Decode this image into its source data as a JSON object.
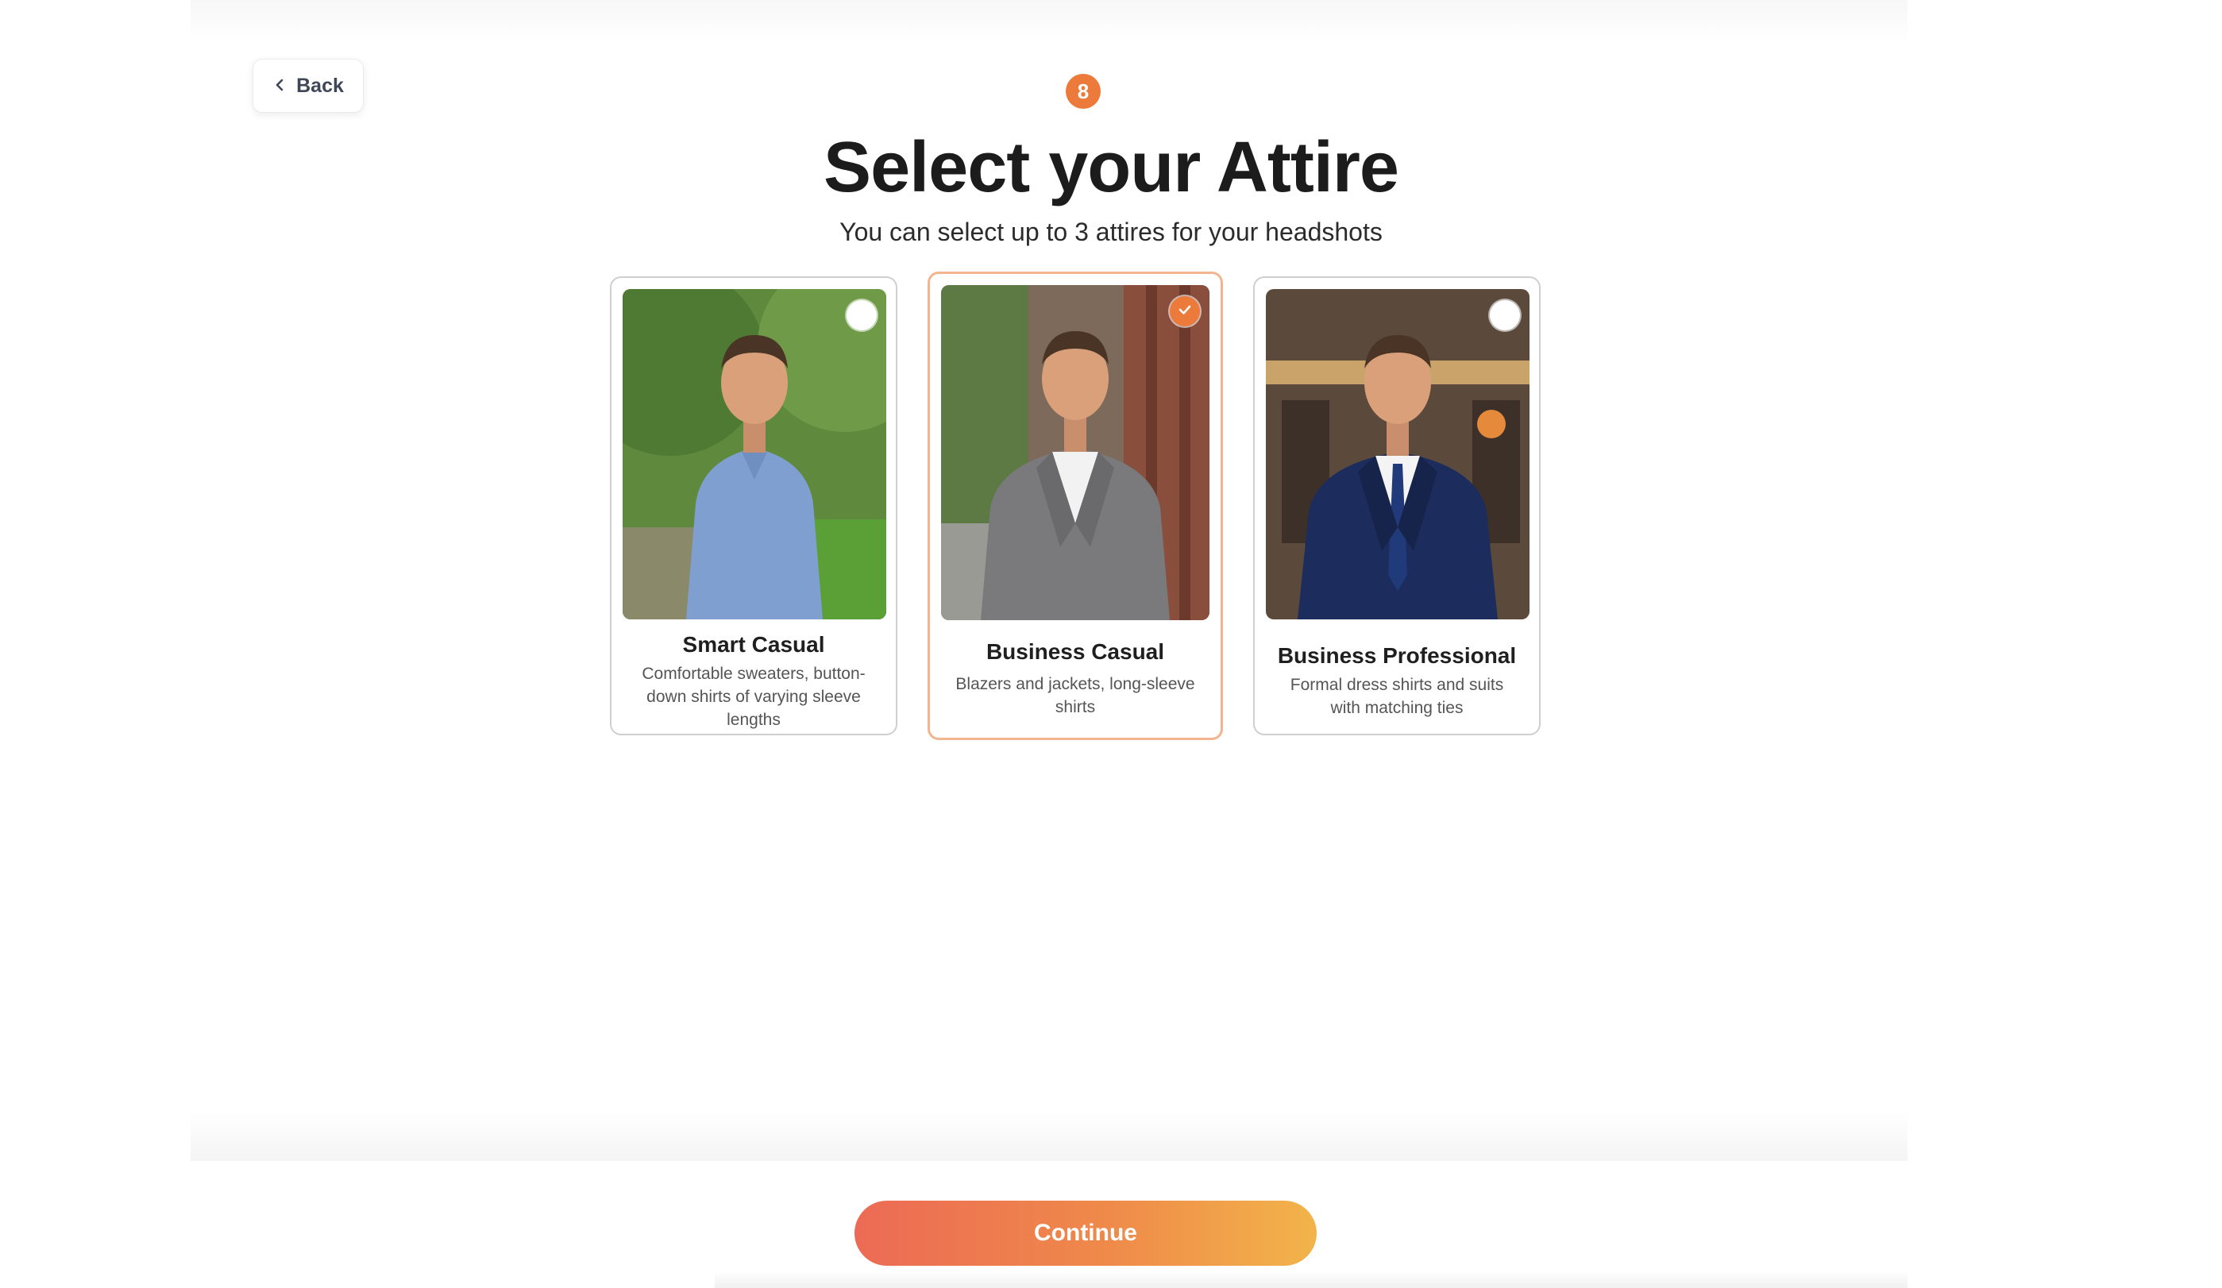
{
  "header": {
    "back_label": "Back",
    "step_number": "8",
    "title": "Select your Attire",
    "subtitle": "You can select up to 3 attires for your headshots"
  },
  "attires": [
    {
      "name": "Smart Casual",
      "description": "Comfortable sweaters, button-down shirts of varying sleeve lengths",
      "selected": false
    },
    {
      "name": "Business Casual",
      "description": "Blazers and jackets, long-sleeve shirts",
      "selected": true
    },
    {
      "name": "Business Professional",
      "description": "Formal dress shirts and suits with matching ties",
      "selected": false
    }
  ],
  "footer": {
    "continue_label": "Continue"
  },
  "colors": {
    "accent": "#ec7a3a",
    "selected_border": "#f2b58f",
    "continue_gradient_start": "#ec6a55",
    "continue_gradient_end": "#f2b44a"
  }
}
